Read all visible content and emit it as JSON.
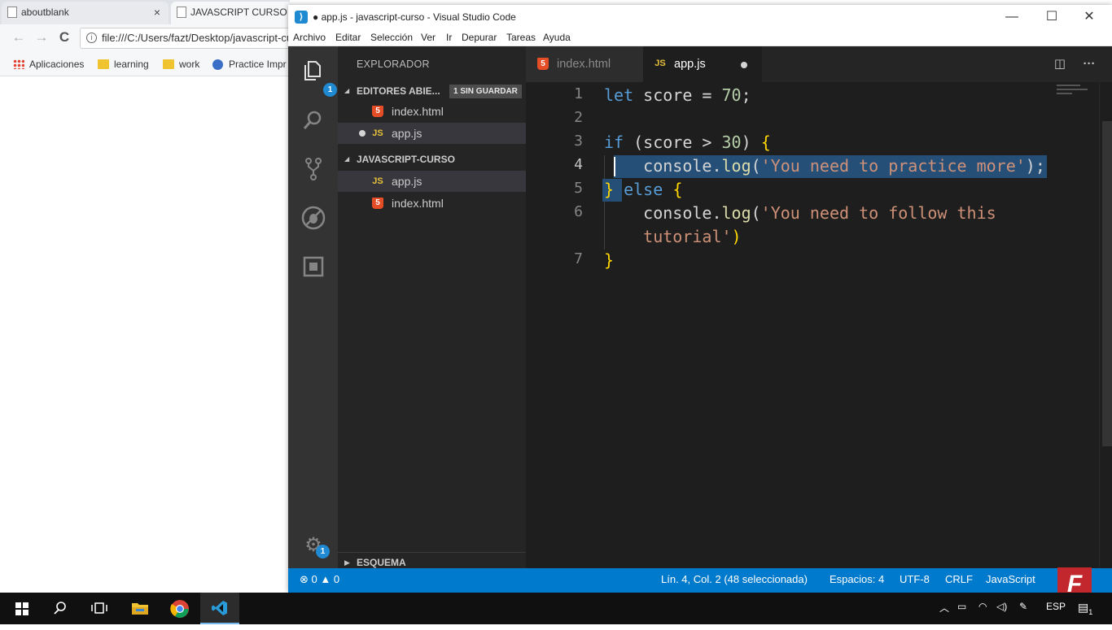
{
  "browser": {
    "tabs": [
      {
        "label": "aboutblank",
        "close": "×"
      },
      {
        "label": "JAVASCRIPT CURSO"
      }
    ],
    "nav": {
      "back": "←",
      "forward": "→",
      "reload": "C"
    },
    "url": "file:///C:/Users/fazt/Desktop/javascript-curso/index.html",
    "bookmarks": [
      "Aplicaciones",
      "learning",
      "work",
      "Practice Impr"
    ]
  },
  "vscode": {
    "window_title": "● app.js - javascript-curso - Visual Studio Code",
    "window_controls": {
      "minimize": "—",
      "maximize": "☐",
      "close": "✕"
    },
    "menu": [
      "Archivo",
      "Editar",
      "Selección",
      "Ver",
      "Ir",
      "Depurar",
      "Tareas",
      "Ayuda"
    ],
    "activity_badges": {
      "explorer": "1",
      "settings": "1"
    },
    "sidebar": {
      "title": "EXPLORADOR",
      "open_editors": {
        "label": "EDITORES ABIE...",
        "badge": "1 SIN GUARDAR",
        "items": [
          {
            "name": "index.html",
            "icon": "html5-icon"
          },
          {
            "name": "app.js",
            "icon": "js-icon",
            "unsaved": true
          }
        ]
      },
      "project": {
        "label": "JAVASCRIPT-CURSO",
        "items": [
          {
            "name": "app.js",
            "icon": "js-icon"
          },
          {
            "name": "index.html",
            "icon": "html5-icon"
          }
        ]
      },
      "outline_label": "ESQUEMA"
    },
    "tabs": [
      {
        "label": "index.html",
        "icon_text": "5",
        "active": false
      },
      {
        "label": "app.js",
        "icon_text": "JS",
        "active": true,
        "dirty": true
      }
    ],
    "editor": {
      "line_numbers": [
        "1",
        "2",
        "3",
        "4",
        "5",
        "6",
        "7"
      ],
      "code": {
        "l1_let": "let",
        "l1_rest": " score = ",
        "l1_num": "70",
        "l1_end": ";",
        "l3_if": "if",
        "l3_open": " (score > ",
        "l3_num": "30",
        "l3_close": ") ",
        "l3_brace": "{",
        "l4_indent": "    ",
        "l4_obj": "console.",
        "l4_fn": "log",
        "l4_paren": "(",
        "l4_str": "'You need to practice more'",
        "l4_end": ");",
        "l5_brace": "}",
        "l5_else": "else",
        "l5_open": " ",
        "l5_brace2": "{",
        "l6_indent": "    ",
        "l6_obj": "console.",
        "l6_fn": "log",
        "l6_paren": "(",
        "l6_str": "'You need to follow this",
        "l6b_indent": "    ",
        "l6b_str": "tutorial'",
        "l6b_end": ")",
        "l7_brace": "}"
      }
    },
    "statusbar": {
      "errors": "0",
      "warnings": "0",
      "position": "Lín. 4, Col. 2 (48 seleccionada)",
      "spaces": "Espacios: 4",
      "encoding": "UTF-8",
      "eol": "CRLF",
      "language": "JavaScript"
    }
  },
  "watermark": "F",
  "taskbar": {
    "language": "ESP",
    "notification_badge": "1"
  },
  "colors": {
    "statusbar": "#007acc",
    "editor_bg": "#1e1e1e",
    "sidebar_bg": "#252526",
    "activitybar_bg": "#333333",
    "selection": "#264f78"
  }
}
